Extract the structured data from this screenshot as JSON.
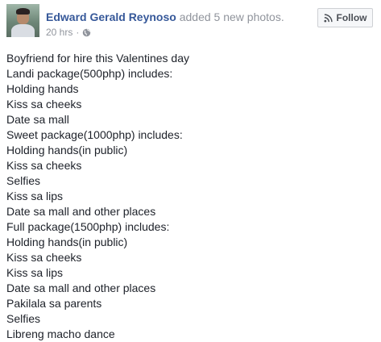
{
  "post": {
    "author": "Edward Gerald Reynoso",
    "action": "added 5 new photos.",
    "timestamp": "20 hrs",
    "separator": "·",
    "privacy_icon": "globe-icon",
    "follow_label": "Follow",
    "follow_icon": "rss-icon",
    "lines": [
      "Boyfriend for hire this Valentines day",
      "Landi package(500php) includes:",
      "Holding hands",
      "Kiss sa cheeks",
      "Date sa mall",
      "Sweet package(1000php) includes:",
      "Holding hands(in public)",
      "Kiss sa cheeks",
      "Selfies",
      "Kiss sa lips",
      "Date sa mall and other places",
      "Full package(1500php) includes:",
      "Holding hands(in public)",
      "Kiss sa cheeks",
      "Kiss sa lips",
      "Date sa mall and other places",
      "Pakilala sa parents",
      "Selfies",
      "Libreng macho dance"
    ]
  },
  "colors": {
    "author": "#365899",
    "muted": "#90949c",
    "text": "#1d2129"
  }
}
